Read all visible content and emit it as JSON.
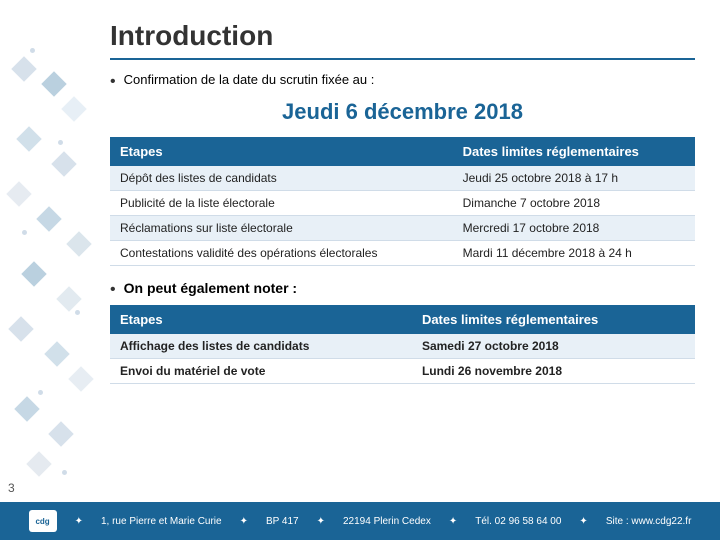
{
  "title": "Introduction",
  "bullet1": "Confirmation de la date du scrutin fixée au :",
  "date_highlight": "Jeudi 6 décembre 2018",
  "table1": {
    "col1_header": "Etapes",
    "col2_header": "Dates limites réglementaires",
    "rows": [
      {
        "etape": "Dépôt des listes de candidats",
        "date": "Jeudi 25 octobre 2018 à 17 h"
      },
      {
        "etape": "Publicité de la liste électorale",
        "date": "Dimanche 7 octobre 2018"
      },
      {
        "etape": "Réclamations sur liste électorale",
        "date": "Mercredi 17 octobre 2018"
      },
      {
        "etape": "Contestations validité des opérations électorales",
        "date": "Mardi 11 décembre 2018 à 24 h"
      }
    ]
  },
  "bullet2": "On peut également noter :",
  "table2": {
    "col1_header": "Etapes",
    "col2_header": "Dates limites réglementaires",
    "rows": [
      {
        "etape": "Affichage des listes de candidats",
        "date": "Samedi 27 octobre 2018"
      },
      {
        "etape": "Envoi du matériel de vote",
        "date": "Lundi 26 novembre 2018"
      }
    ]
  },
  "footer": {
    "items": [
      "1, rue Pierre et Marie Curie",
      "BP 417",
      "22194 Plerin Cedex",
      "Tél. 02 96 58 64 00",
      "Site : www.cdg22.fr"
    ]
  },
  "page_number": "3"
}
